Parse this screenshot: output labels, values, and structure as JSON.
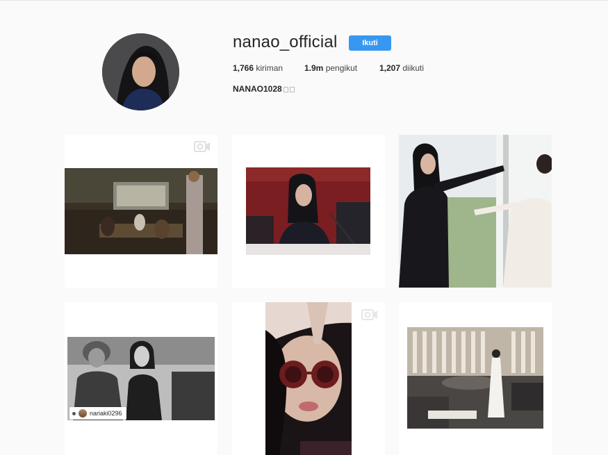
{
  "profile": {
    "username": "nanao_official",
    "follow_label": "Ikuti",
    "posts_count": "1,766",
    "posts_label": "kiriman",
    "followers_count": "1.9m",
    "followers_label": "pengikut",
    "following_count": "1,207",
    "following_label": "diikuti",
    "full_name": "NANAO1028"
  },
  "tags": {
    "post4_user": "nariaki0296"
  },
  "colors": {
    "follow_button": "#3897f0",
    "page_background": "#fafafa"
  },
  "icons": {
    "video": "video-camera-icon"
  }
}
